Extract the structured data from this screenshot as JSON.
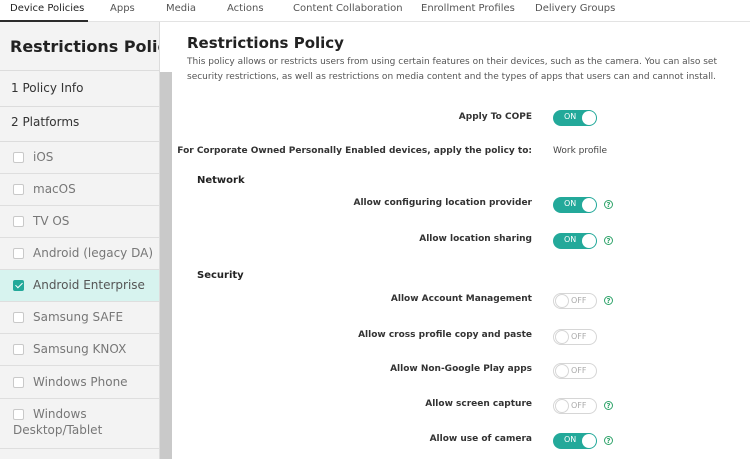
{
  "tabs": [
    "Device Policies",
    "Apps",
    "Media",
    "Actions",
    "Content Collaboration",
    "Enrollment Profiles",
    "Delivery Groups"
  ],
  "sidebar": {
    "title": "Restrictions Policy",
    "steps": [
      "1  Policy Info",
      "2  Platforms"
    ],
    "platforms": [
      {
        "label": "iOS",
        "checked": false
      },
      {
        "label": "macOS",
        "checked": false
      },
      {
        "label": "TV OS",
        "checked": false
      },
      {
        "label": "Android (legacy DA)",
        "checked": false
      },
      {
        "label": "Android Enterprise",
        "checked": true
      },
      {
        "label": "Samsung SAFE",
        "checked": false
      },
      {
        "label": "Samsung KNOX",
        "checked": false
      },
      {
        "label": "Windows Phone",
        "checked": false
      },
      {
        "label": "Windows Desktop/Tablet",
        "checked": false
      }
    ]
  },
  "main": {
    "title": "Restrictions Policy",
    "description": "This policy allows or restricts users from using certain features on their devices, such as the camera. You can also set security restrictions, as well as restrictions on media content and the types of apps that users can and cannot install.",
    "apply_cope": {
      "label": "Apply To COPE",
      "state": "ON"
    },
    "cope_target": {
      "label": "For Corporate Owned Personally Enabled devices, apply the policy to:",
      "value": "Work profile"
    },
    "sections": [
      {
        "title": "Network",
        "rows": [
          {
            "label": "Allow configuring location provider",
            "state": "ON",
            "help": true
          },
          {
            "label": "Allow location sharing",
            "state": "ON",
            "help": true
          }
        ]
      },
      {
        "title": "Security",
        "rows": [
          {
            "label": "Allow Account Management",
            "state": "OFF",
            "help": true
          },
          {
            "label": "Allow cross profile copy and paste",
            "state": "OFF",
            "help": false
          },
          {
            "label": "Allow Non-Google Play apps",
            "state": "OFF",
            "help": false
          },
          {
            "label": "Allow screen capture",
            "state": "OFF",
            "help": true
          },
          {
            "label": "Allow use of camera",
            "state": "ON",
            "help": true
          }
        ]
      }
    ]
  },
  "help_glyph": "?",
  "colors": {
    "accent": "#23a99a",
    "help": "#2fa36a",
    "selected_row": "#d7f3ef"
  }
}
